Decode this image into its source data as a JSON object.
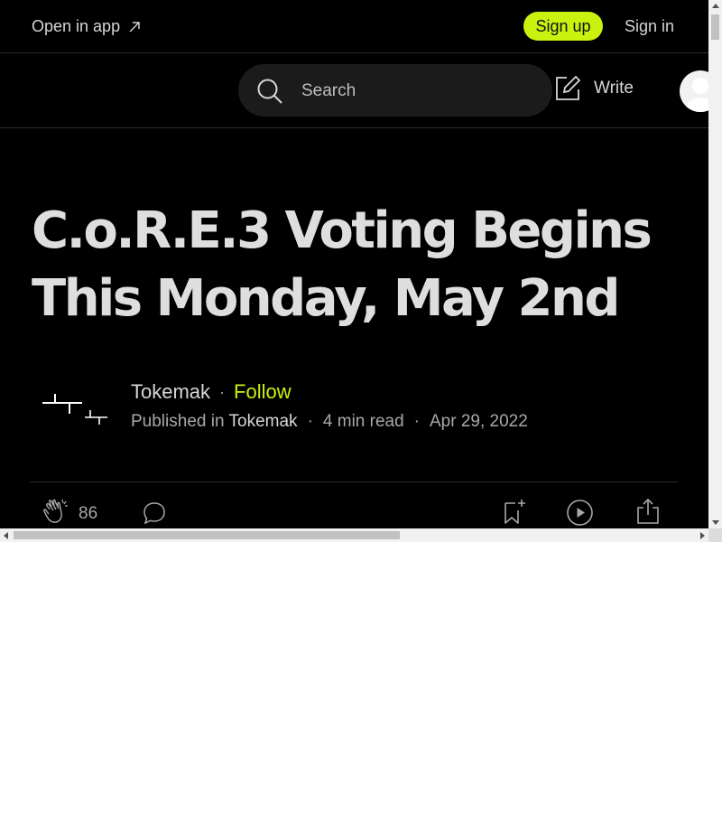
{
  "topbar": {
    "open_app_label": "Open in app",
    "open_app_icon": "arrow-up-right-icon",
    "signup_label": "Sign up",
    "signin_label": "Sign in",
    "accent_color": "#c9f20f"
  },
  "navbar": {
    "search": {
      "placeholder": "Search",
      "icon": "search-icon"
    },
    "write_label": "Write",
    "write_icon": "pencil-icon",
    "avatar_icon": "user-avatar"
  },
  "article": {
    "title_line1": "C.o.R.E.3 Voting Begins",
    "title_line2": "This Monday, May 2nd",
    "author": {
      "name": "Tokemak",
      "follow_label": "Follow",
      "separator": "·"
    },
    "meta": {
      "published_prefix": "Published in",
      "publication": "Tokemak",
      "read_time": "4 min read",
      "date": "Apr 29, 2022",
      "separator": "·"
    },
    "actions": {
      "clap_count": "86",
      "clap_icon": "clap-icon",
      "comment_icon": "comment-icon",
      "bookmark_icon": "bookmark-add-icon",
      "listen_icon": "play-icon",
      "share_icon": "share-icon"
    }
  },
  "colors": {
    "background": "#000000",
    "text_primary": "#dedede",
    "text_secondary": "#a8a8a8"
  }
}
